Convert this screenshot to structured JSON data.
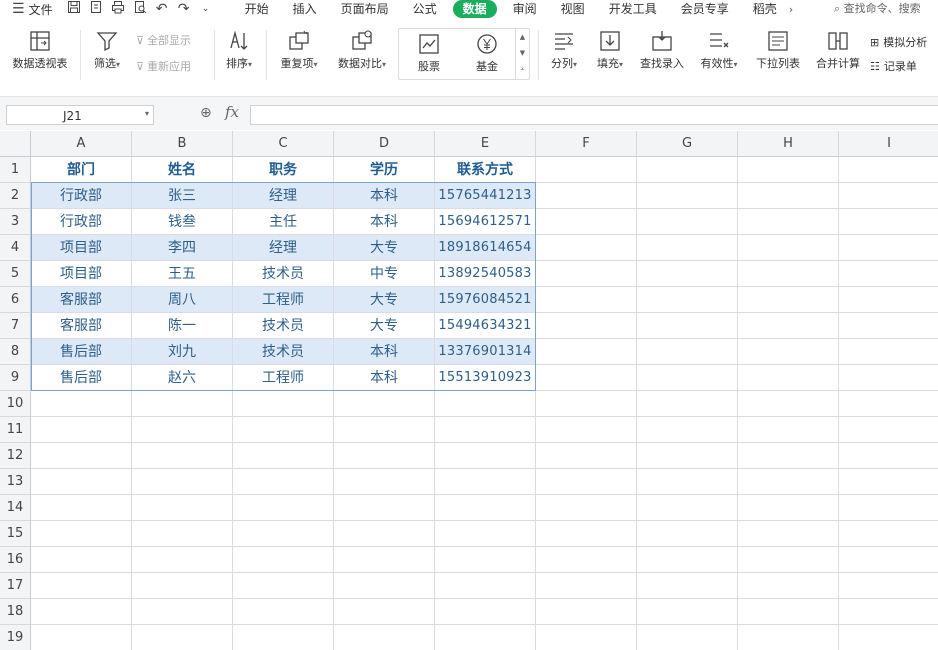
{
  "menubar": {
    "file_label": "文件",
    "tabs": [
      {
        "label": "开始",
        "active": false
      },
      {
        "label": "插入",
        "active": false
      },
      {
        "label": "页面布局",
        "active": false
      },
      {
        "label": "公式",
        "active": false
      },
      {
        "label": "数据",
        "active": true
      },
      {
        "label": "审阅",
        "active": false
      },
      {
        "label": "视图",
        "active": false
      },
      {
        "label": "开发工具",
        "active": false
      },
      {
        "label": "会员专享",
        "active": false
      },
      {
        "label": "稻壳",
        "active": false
      }
    ],
    "search_placeholder": "查找命令、搜索"
  },
  "ribbon": {
    "pivot_table": "数据透视表",
    "filter": "筛选",
    "show_all": "全部显示",
    "reapply": "重新应用",
    "sort": "排序",
    "duplicates": "重复项",
    "compare": "数据对比",
    "stock": "股票",
    "fund": "基金",
    "split": "分列",
    "fill": "填充",
    "lookup_entry": "查找录入",
    "validity": "有效性",
    "dropdown_list": "下拉列表",
    "consolidate": "合并计算",
    "what_if": "模拟分析",
    "form": "记录单"
  },
  "formula_bar": {
    "cell_ref": "J21",
    "fx_label": "fx",
    "formula": ""
  },
  "sheet": {
    "columns": [
      "A",
      "B",
      "C",
      "D",
      "E",
      "F",
      "G",
      "H",
      "I"
    ],
    "rows": [
      "1",
      "2",
      "3",
      "4",
      "5",
      "6",
      "7",
      "8",
      "9",
      "10",
      "11",
      "12",
      "13",
      "14",
      "15",
      "16",
      "17",
      "18",
      "19"
    ],
    "table_header": [
      "部门",
      "姓名",
      "职务",
      "学历",
      "联系方式"
    ],
    "table_rows": [
      [
        "行政部",
        "张三",
        "经理",
        "本科",
        "15765441213"
      ],
      [
        "行政部",
        "钱叁",
        "主任",
        "本科",
        "15694612571"
      ],
      [
        "项目部",
        "李四",
        "经理",
        "大专",
        "18918614654"
      ],
      [
        "项目部",
        "王五",
        "技术员",
        "中专",
        "13892540583"
      ],
      [
        "客服部",
        "周八",
        "工程师",
        "大专",
        "15976084521"
      ],
      [
        "客服部",
        "陈一",
        "技术员",
        "大专",
        "15494634321"
      ],
      [
        "售后部",
        "刘九",
        "技术员",
        "本科",
        "13376901314"
      ],
      [
        "售后部",
        "赵六",
        "工程师",
        "本科",
        "15513910923"
      ]
    ]
  },
  "colors": {
    "accent_tab": "#1aad5c",
    "band_fill": "#dde9f7",
    "header_text": "#1f5c94",
    "cell_text": "#2e5f8a"
  }
}
